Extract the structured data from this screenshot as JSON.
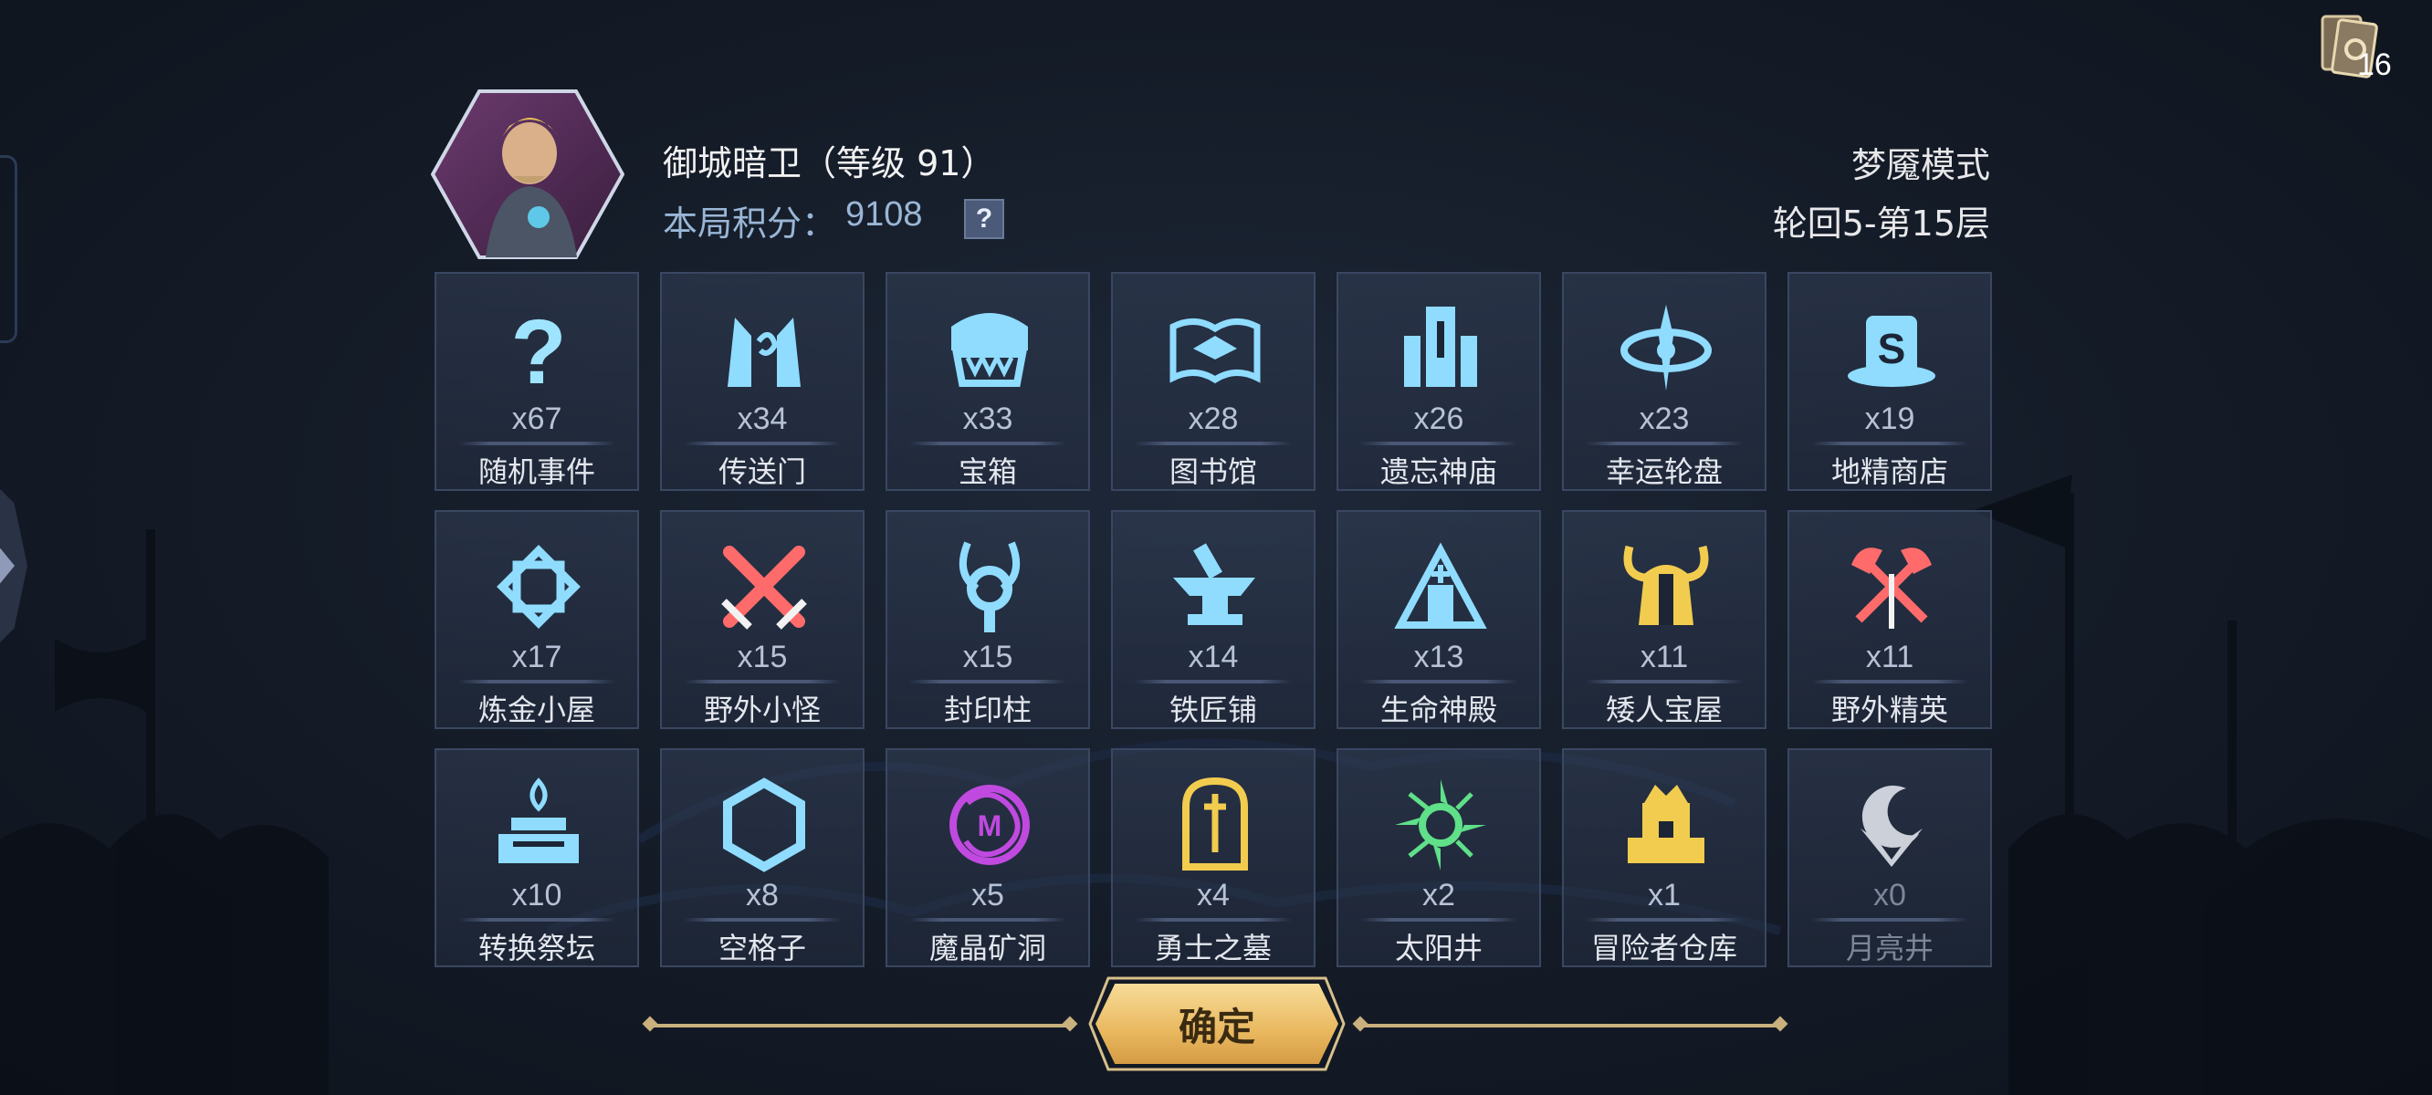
{
  "header": {
    "hero_name": "御城暗卫（等级 91）",
    "score_label": "本局积分：",
    "score_value": "9108",
    "help_label": "?",
    "mode": "梦魇模式",
    "floor": "轮回5-第15层"
  },
  "deck": {
    "count": "16",
    "icon": "card-deck-icon"
  },
  "tiles": [
    {
      "count": "x67",
      "label": "随机事件",
      "icon": "question-mark-icon",
      "color": "#9fe4ff"
    },
    {
      "count": "x34",
      "label": "传送门",
      "icon": "portal-icon",
      "color": "#8fdcff"
    },
    {
      "count": "x33",
      "label": "宝箱",
      "icon": "treasure-chest-icon",
      "color": "#8fdcff"
    },
    {
      "count": "x28",
      "label": "图书馆",
      "icon": "open-book-icon",
      "color": "#8fdcff"
    },
    {
      "count": "x26",
      "label": "遗忘神庙",
      "icon": "temple-icon",
      "color": "#8fdcff"
    },
    {
      "count": "x23",
      "label": "幸运轮盘",
      "icon": "wheel-icon",
      "color": "#8fdcff"
    },
    {
      "count": "x19",
      "label": "地精商店",
      "icon": "goblin-shop-icon",
      "color": "#8fdcff"
    },
    {
      "count": "x17",
      "label": "炼金小屋",
      "icon": "alchemy-icon",
      "color": "#8fdcff"
    },
    {
      "count": "x15",
      "label": "野外小怪",
      "icon": "crossed-swords-icon",
      "color": "#ff6b6b"
    },
    {
      "count": "x15",
      "label": "封印柱",
      "icon": "seal-pillar-icon",
      "color": "#8fdcff"
    },
    {
      "count": "x14",
      "label": "铁匠铺",
      "icon": "anvil-icon",
      "color": "#8fdcff"
    },
    {
      "count": "x13",
      "label": "生命神殿",
      "icon": "life-shrine-icon",
      "color": "#8fdcff"
    },
    {
      "count": "x11",
      "label": "矮人宝屋",
      "icon": "dwarf-helmet-icon",
      "color": "#f2cc4e"
    },
    {
      "count": "x11",
      "label": "野外精英",
      "icon": "crossed-axes-icon",
      "color": "#ff6b6b"
    },
    {
      "count": "x10",
      "label": "转换祭坛",
      "icon": "altar-icon",
      "color": "#8fdcff"
    },
    {
      "count": "x8",
      "label": "空格子",
      "icon": "hexagon-icon",
      "color": "#8fdcff"
    },
    {
      "count": "x5",
      "label": "魔晶矿洞",
      "icon": "crystal-mine-icon",
      "color": "#c04ae0"
    },
    {
      "count": "x4",
      "label": "勇士之墓",
      "icon": "tombstone-icon",
      "color": "#f2cc4e"
    },
    {
      "count": "x2",
      "label": "太阳井",
      "icon": "sun-well-icon",
      "color": "#5fe089"
    },
    {
      "count": "x1",
      "label": "冒险者仓库",
      "icon": "warehouse-icon",
      "color": "#f2cc4e"
    },
    {
      "count": "x0",
      "label": "月亮井",
      "icon": "moon-well-icon",
      "color": "#e9edf5"
    }
  ],
  "confirm_label": "确定"
}
